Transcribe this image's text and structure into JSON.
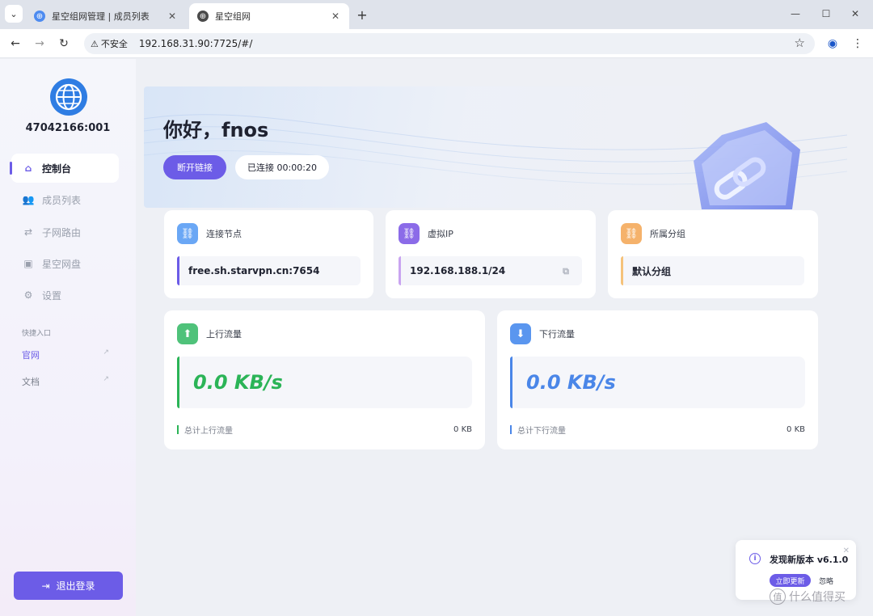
{
  "browser": {
    "tabs": [
      {
        "title": "星空组网管理 | 成员列表",
        "active": false
      },
      {
        "title": "星空组网",
        "active": true
      }
    ],
    "security_label": "不安全",
    "url": "192.168.31.90:7725/#/"
  },
  "sidebar": {
    "node_id": "47042166:001",
    "menu": [
      {
        "label": "控制台",
        "icon": "home-icon",
        "active": true
      },
      {
        "label": "成员列表",
        "icon": "members-icon",
        "active": false
      },
      {
        "label": "子网路由",
        "icon": "route-icon",
        "active": false
      },
      {
        "label": "星空网盘",
        "icon": "cloud-disk-icon",
        "active": false
      },
      {
        "label": "设置",
        "icon": "gear-icon",
        "active": false
      }
    ],
    "quick_title": "快捷入口",
    "quick_links": [
      {
        "label": "官网",
        "color": "#6c5ce7"
      },
      {
        "label": "文档",
        "color": "#7b808c"
      }
    ],
    "logout_label": "退出登录"
  },
  "hero": {
    "greeting": "你好，fnos",
    "disconnect_label": "断开链接",
    "status_text": "已连接 00:00:20"
  },
  "cards": {
    "node": {
      "title": "连接节点",
      "value": "free.sh.starvpn.cn:7654",
      "icon": "link-icon",
      "color": "#6aa7f5"
    },
    "vip": {
      "title": "虚拟IP",
      "value": "192.168.188.1/24",
      "icon": "link-icon",
      "color": "#8b6be8"
    },
    "group": {
      "title": "所属分组",
      "value": "默认分组",
      "icon": "link-icon",
      "color": "#f5b26b"
    }
  },
  "traffic": {
    "up": {
      "title": "上行流量",
      "speed": "0.0 KB/s",
      "total_label": "总计上行流量",
      "total_value": "0 KB",
      "icon": "arrow-up-icon",
      "color": "#2bb457"
    },
    "down": {
      "title": "下行流量",
      "speed": "0.0 KB/s",
      "total_label": "总计下行流量",
      "total_value": "0 KB",
      "icon": "arrow-down-icon",
      "color": "#4a86e8"
    }
  },
  "toast": {
    "message": "发现新版本 v6.1.0",
    "update_label": "立即更新",
    "ignore_label": "忽略"
  },
  "watermark": {
    "mark": "值",
    "text": "什么值得买"
  },
  "colors": {
    "accent": "#6c5ce7",
    "up": "#2bb457",
    "down": "#4a86e8"
  }
}
